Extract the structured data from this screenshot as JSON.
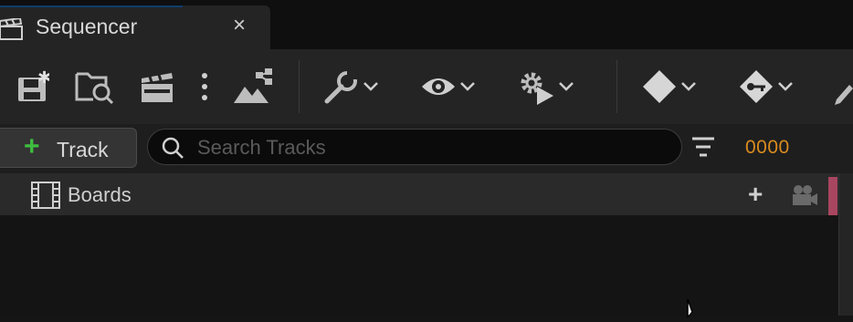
{
  "tab": {
    "title": "Sequencer",
    "close_glyph": "×",
    "icon": "clapperboard-icon"
  },
  "toolbar": {
    "buttons": [
      {
        "name": "save-button",
        "icon": "save-icon"
      },
      {
        "name": "find-in-content-browser-button",
        "icon": "folder-search-icon"
      },
      {
        "name": "render-movie-button",
        "icon": "clapperboard-icon"
      },
      {
        "name": "more-options-button",
        "icon": "vertical-ellipsis-icon"
      },
      {
        "name": "open-director-button",
        "icon": "hierarchy-icon"
      },
      {
        "name": "actions-menu",
        "icon": "wrench-icon"
      },
      {
        "name": "view-options-menu",
        "icon": "eye-icon"
      },
      {
        "name": "playback-options-menu",
        "icon": "gear-play-icon"
      },
      {
        "name": "keyframe-options-menu",
        "icon": "diamond-icon"
      },
      {
        "name": "key-options-menu",
        "icon": "diamond-key-icon"
      },
      {
        "name": "edit-options-menu",
        "icon": "pencil-icon"
      }
    ]
  },
  "trackbar": {
    "add_label": "Track",
    "search_placeholder": "Search Tracks",
    "search_value": "",
    "frame_value": "0000",
    "frame_color": "#d98c1f"
  },
  "outliner": {
    "rows": [
      {
        "label": "Boards",
        "icon": "filmstrip-icon",
        "marker_color": "#a84660"
      }
    ]
  },
  "colors": {
    "accent_green": "#3fbf3f",
    "tab_accent": "#0e3d6b"
  }
}
